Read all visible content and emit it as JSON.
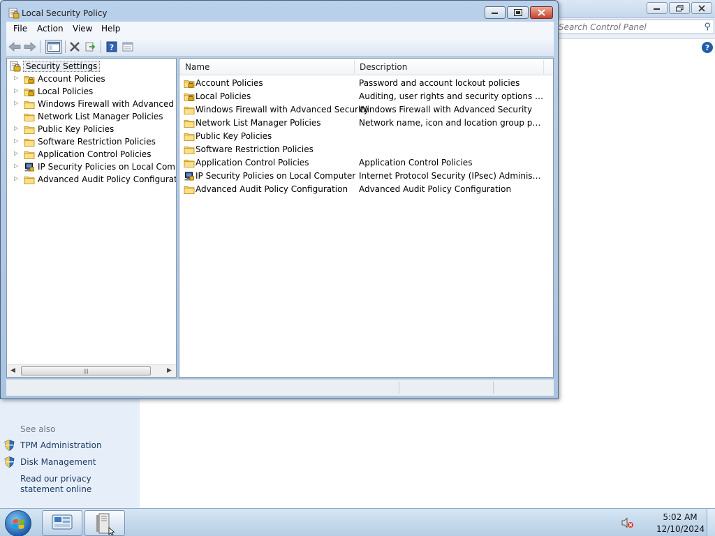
{
  "window": {
    "title": "Local Security Policy"
  },
  "menu": {
    "items": [
      {
        "label": "File"
      },
      {
        "label": "Action"
      },
      {
        "label": "View"
      },
      {
        "label": "Help"
      }
    ]
  },
  "toolbar": {
    "buttons": [
      "back-arrow-icon",
      "forward-arrow-icon",
      "show-hide-console-tree-icon",
      "delete-icon",
      "export-list-icon",
      "help-icon",
      "properties-icon"
    ]
  },
  "tree": {
    "root": "Security Settings",
    "items": [
      {
        "label": "Account Policies",
        "expandable": true,
        "icon": "lock-folder-icon"
      },
      {
        "label": "Local Policies",
        "expandable": true,
        "icon": "lock-folder-icon"
      },
      {
        "label": "Windows Firewall with Advanced Security",
        "expandable": true,
        "icon": "folder-icon"
      },
      {
        "label": "Network List Manager Policies",
        "expandable": false,
        "icon": "folder-icon"
      },
      {
        "label": "Public Key Policies",
        "expandable": true,
        "icon": "folder-icon"
      },
      {
        "label": "Software Restriction Policies",
        "expandable": true,
        "icon": "folder-icon"
      },
      {
        "label": "Application Control Policies",
        "expandable": true,
        "icon": "folder-icon"
      },
      {
        "label": "IP Security Policies on Local Computer",
        "expandable": true,
        "icon": "ip-security-icon"
      },
      {
        "label": "Advanced Audit Policy Configuration",
        "expandable": true,
        "icon": "folder-icon"
      }
    ]
  },
  "list": {
    "columns": {
      "name": "Name",
      "description": "Description"
    },
    "rows": [
      {
        "name": "Account Policies",
        "description": "Password and account lockout policies",
        "icon": "lock-folder-icon"
      },
      {
        "name": "Local Policies",
        "description": "Auditing, user rights and security options polici...",
        "icon": "lock-folder-icon"
      },
      {
        "name": "Windows Firewall with Advanced Security",
        "description": "Windows Firewall with Advanced Security",
        "icon": "folder-icon"
      },
      {
        "name": "Network List Manager Policies",
        "description": "Network name, icon and location group policies.",
        "icon": "folder-icon"
      },
      {
        "name": "Public Key Policies",
        "description": "",
        "icon": "folder-icon"
      },
      {
        "name": "Software Restriction Policies",
        "description": "",
        "icon": "folder-icon"
      },
      {
        "name": "Application Control Policies",
        "description": "Application Control Policies",
        "icon": "folder-icon"
      },
      {
        "name": "IP Security Policies on Local Computer",
        "description": "Internet Protocol Security (IPsec) Administratio...",
        "icon": "ip-security-icon"
      },
      {
        "name": "Advanced Audit Policy Configuration",
        "description": "Advanced Audit Policy Configuration",
        "icon": "folder-icon"
      }
    ]
  },
  "control_panel": {
    "search_placeholder": "Search Control Panel",
    "see_also": "See also",
    "links": [
      {
        "label": "TPM Administration",
        "icon": "shield-icon"
      },
      {
        "label": "Disk Management",
        "icon": "shield-icon"
      },
      {
        "label": "Read our privacy statement online",
        "icon": ""
      }
    ]
  },
  "taskbar": {
    "time": "5:02 AM",
    "date": "12/10/2024",
    "tasks": [
      "control-panel-icon",
      "local-security-policy-icon"
    ]
  },
  "colors": {
    "title_gradient_top": "#b9d1ea",
    "close_button": "#c8432d",
    "link": "#1e3c64"
  }
}
